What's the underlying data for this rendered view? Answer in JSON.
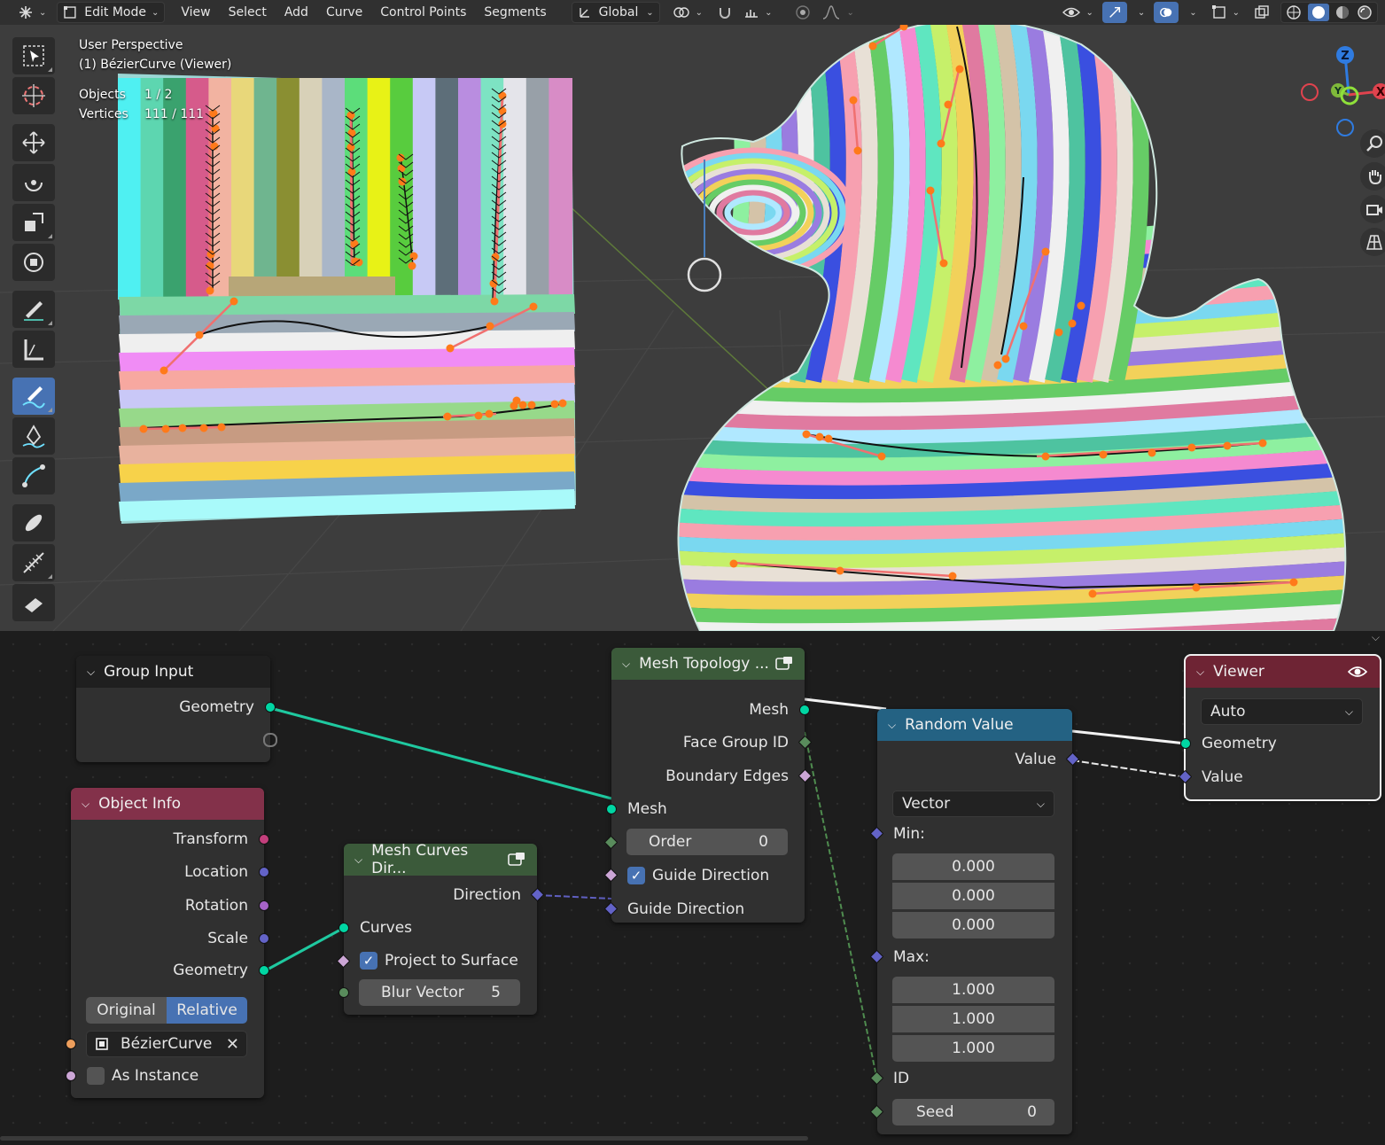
{
  "header": {
    "mode": "Edit Mode",
    "menus": [
      "View",
      "Select",
      "Add",
      "Curve",
      "Control Points",
      "Segments"
    ],
    "transform_orientation": "Global"
  },
  "viewport": {
    "perspective": "User Perspective",
    "object_name": "(1) BézierCurve (Viewer)",
    "objects_label": "Objects",
    "objects_value": "1 / 2",
    "vertices_label": "Vertices",
    "vertices_value": "111 / 111",
    "gizmo_axes": [
      "Z",
      "Y",
      "X"
    ]
  },
  "nodes": {
    "group_input": {
      "title": "Group Input",
      "geometry": "Geometry"
    },
    "object_info": {
      "title": "Object Info",
      "outputs": [
        "Transform",
        "Location",
        "Rotation",
        "Scale",
        "Geometry"
      ],
      "mode_original": "Original",
      "mode_relative": "Relative",
      "object": "BézierCurve",
      "as_instance": "As Instance"
    },
    "mesh_curves_dir": {
      "title": "Mesh Curves Dir...",
      "direction": "Direction",
      "curves": "Curves",
      "project_to_surface": "Project to Surface",
      "blur_vector_label": "Blur Vector",
      "blur_vector_value": "5"
    },
    "mesh_topology": {
      "title": "Mesh Topology ...",
      "out_mesh": "Mesh",
      "face_group_id": "Face Group ID",
      "boundary_edges": "Boundary Edges",
      "in_mesh": "Mesh",
      "order_label": "Order",
      "order_value": "0",
      "guide_direction_check": "Guide Direction",
      "guide_direction": "Guide Direction"
    },
    "random_value": {
      "title": "Random Value",
      "value": "Value",
      "type": "Vector",
      "min_label": "Min:",
      "min": [
        "0.000",
        "0.000",
        "0.000"
      ],
      "max_label": "Max:",
      "max": [
        "1.000",
        "1.000",
        "1.000"
      ],
      "id": "ID",
      "seed_label": "Seed",
      "seed_value": "0"
    },
    "viewer": {
      "title": "Viewer",
      "domain": "Auto",
      "geometry": "Geometry",
      "value": "Value"
    }
  },
  "colors": {
    "accent": "#4772b3",
    "geometry_socket": "#00d6a3",
    "vector_socket": "#6363c7",
    "int_socket": "#598c5c",
    "bool_socket": "#cca6d6",
    "object_info_header": "#83314a",
    "group_input_header": "#1d1d1d",
    "mesh_header": "#3b5a3a",
    "random_header": "#246283",
    "viewer_header": "#6e2434"
  }
}
